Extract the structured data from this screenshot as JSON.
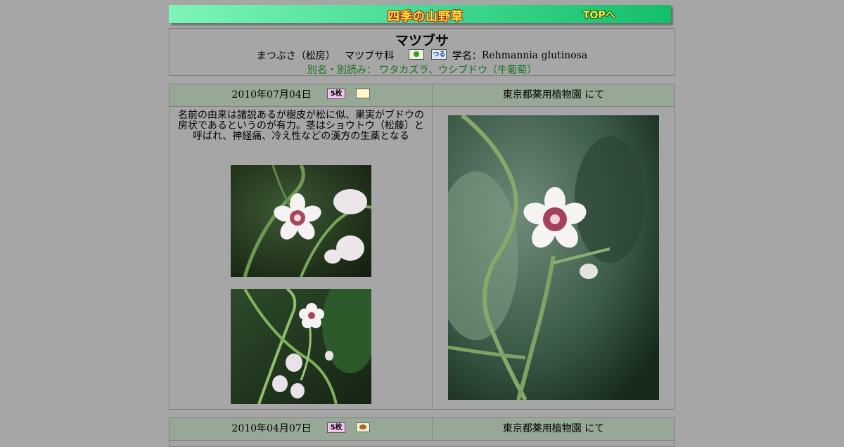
{
  "banner": {
    "title": "四季の山野草",
    "top_link": "TOPへ"
  },
  "plant": {
    "name": "マツブサ",
    "reading": "まつぶさ（松房）",
    "family": "マツブサ科",
    "scientific_label": "学名：",
    "scientific_name": "Rehmannia glutinosa",
    "aliases": "別名・別読み： ワタカズラ、ウシブドウ（牛葡萄）"
  },
  "entries": [
    {
      "date": "2010年07月04日",
      "badge": "5枚",
      "location": "東京都薬用植物園 にて",
      "description": "名前の由来は諸説あるが樹皮が松に似、果実がブドウの房状であるというのが有力。茎はショウトウ（松藤）と呼ばれ、神経痛、冷え性などの漢方の生薬となる"
    },
    {
      "date": "2010年04月07日",
      "badge": "5枚",
      "location": "東京都薬用植物園 にて"
    }
  ],
  "icons": {
    "plant_type": "plant-icon",
    "vine": "vine-icon",
    "photo_count": "photo-count-badge",
    "season_spring": "flower-thumb-icon",
    "season_bud": "bud-thumb-icon"
  },
  "colors": {
    "page_bg": "#a6a6a6",
    "banner_start": "#7df5b8",
    "banner_end": "#14bf6a",
    "header_cell": "#97a897",
    "alias_text": "#13701b"
  }
}
